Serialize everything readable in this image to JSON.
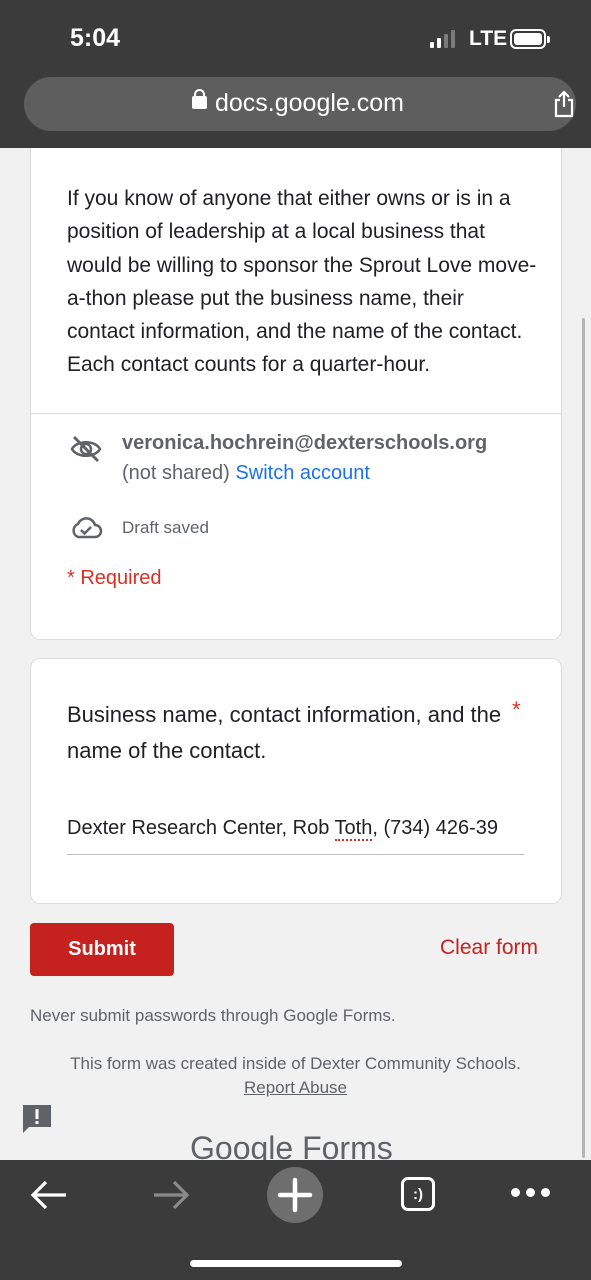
{
  "status_bar": {
    "time": "5:04",
    "network": "LTE",
    "signal_bars": 4,
    "signal_bars_active": 2
  },
  "browser": {
    "url": "docs.google.com",
    "lock_icon": "lock-icon",
    "share_icon": "share-icon"
  },
  "form": {
    "description": "If you know of anyone that either owns or is in a position of leadership at a local business that would be willing to sponsor the Sprout Love move-a-thon please put the business name, their contact information, and the name of the contact. Each contact counts for a quarter-hour.",
    "account_email": "veronica.hochrein@dexterschools.org",
    "not_shared": "(not shared)",
    "switch_account": "Switch account",
    "draft_status": "Draft saved",
    "required_note": "* Required"
  },
  "question": {
    "label": "Business name, contact information, and the name of the contact.",
    "required_star": "*",
    "answer_prefix": "Dexter Research Center, Rob ",
    "answer_misspelled": "Toth",
    "answer_suffix": ", (734) 426-39"
  },
  "actions": {
    "submit": "Submit",
    "clear": "Clear form"
  },
  "footer": {
    "warning": "Never submit passwords through Google Forms.",
    "created_by": "This form was created inside of Dexter Community Schools.",
    "report_abuse": "Report Abuse",
    "logo_google": "Google",
    "logo_forms": "Forms"
  },
  "toolbar": {
    "tabs_label": ":)"
  },
  "colors": {
    "accent_red": "#c5221f",
    "link_blue": "#1a73e8",
    "chrome_dark": "#3b3b3b"
  }
}
